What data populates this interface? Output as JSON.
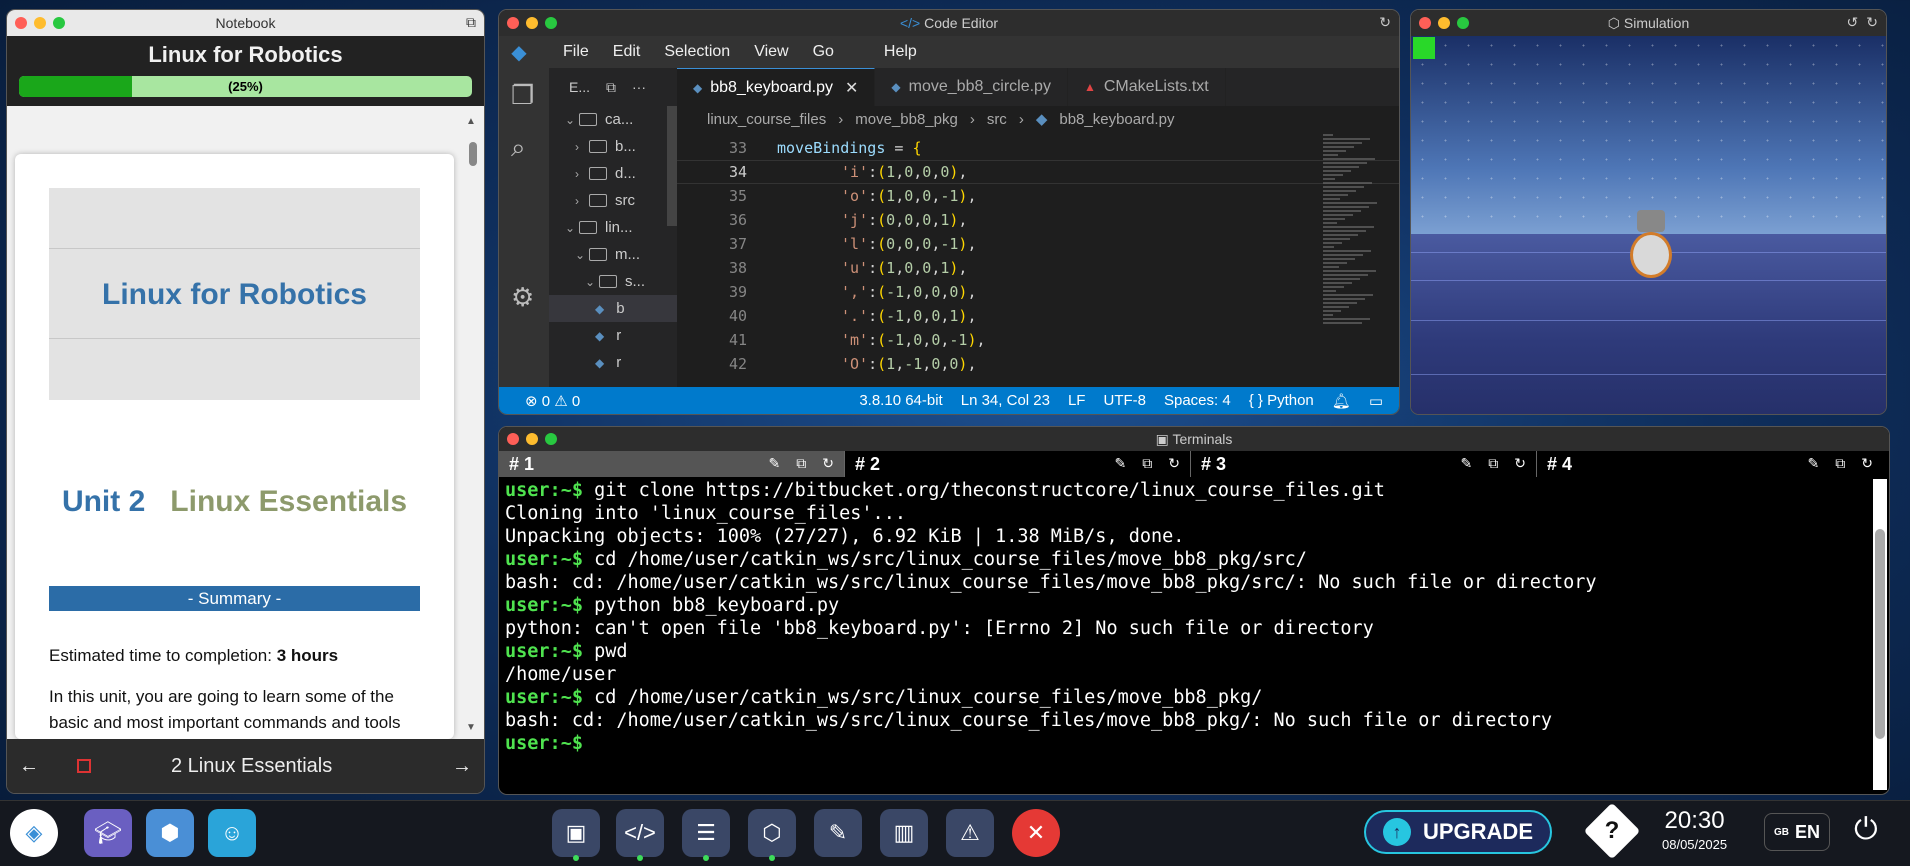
{
  "notebook": {
    "window_title": "Notebook",
    "header_title": "Linux for Robotics",
    "progress_label": "(25%)",
    "progress_fraction": 0.25,
    "hero_title": "Linux for Robotics",
    "unit_number": "Unit 2",
    "unit_name": "Linux Essentials",
    "summary_label": "- Summary -",
    "estimated_label": "Estimated time to completion: ",
    "estimated_value": "3 hours",
    "intro_text": "In this unit, you are going to learn some of the basic and most important commands and tools",
    "footer_label": "2  Linux Essentials"
  },
  "code_editor": {
    "window_title": "Code Editor",
    "menu": [
      "File",
      "Edit",
      "Selection",
      "View",
      "Go",
      "Help"
    ],
    "explorer_header": "E...",
    "tree": [
      {
        "label": "ca...",
        "indent": 0,
        "type": "folder-open"
      },
      {
        "label": "b...",
        "indent": 1,
        "type": "folder"
      },
      {
        "label": "d...",
        "indent": 1,
        "type": "folder"
      },
      {
        "label": "src",
        "indent": 1,
        "type": "folder"
      },
      {
        "label": "lin...",
        "indent": 0,
        "type": "folder-open"
      },
      {
        "label": "m...",
        "indent": 1,
        "type": "folder-open"
      },
      {
        "label": "s...",
        "indent": 2,
        "type": "folder-open"
      },
      {
        "label": "b",
        "indent": 3,
        "type": "file-selected"
      },
      {
        "label": "r",
        "indent": 3,
        "type": "file"
      },
      {
        "label": "r",
        "indent": 3,
        "type": "file"
      }
    ],
    "tabs": [
      {
        "label": "bb8_keyboard.py",
        "active": true
      },
      {
        "label": "move_bb8_circle.py",
        "active": false
      },
      {
        "label": "CMakeLists.txt",
        "active": false
      }
    ],
    "breadcrumb": [
      "linux_course_files",
      "move_bb8_pkg",
      "src",
      "bb8_keyboard.py"
    ],
    "code_lines": [
      {
        "num": "33",
        "text": "moveBindings = {"
      },
      {
        "num": "34",
        "text": "'i':(1,0,0,0),"
      },
      {
        "num": "35",
        "text": "'o':(1,0,0,-1),"
      },
      {
        "num": "36",
        "text": "'j':(0,0,0,1),"
      },
      {
        "num": "37",
        "text": "'l':(0,0,0,-1),"
      },
      {
        "num": "38",
        "text": "'u':(1,0,0,1),"
      },
      {
        "num": "39",
        "text": "',':(-1,0,0,0),"
      },
      {
        "num": "40",
        "text": "'.':(-1,0,0,1),"
      },
      {
        "num": "41",
        "text": "'m':(-1,0,0,-1),"
      },
      {
        "num": "42",
        "text": "'O':(1,-1,0,0),"
      }
    ],
    "status": {
      "problems": "⊗ 0 ⚠ 0",
      "python_version": "3.8.10 64-bit",
      "cursor": "Ln 34, Col 23",
      "eol": "LF",
      "encoding": "UTF-8",
      "spaces": "Spaces: 4",
      "language": "Python"
    }
  },
  "simulation": {
    "window_title": "Simulation"
  },
  "terminals": {
    "window_title": "Terminals",
    "tabs": [
      "# 1",
      "# 2",
      "# 3",
      "# 4"
    ],
    "lines": [
      {
        "prompt": "user:~$",
        "text": " git clone https://bitbucket.org/theconstructcore/linux_course_files.git"
      },
      {
        "prompt": "",
        "text": "Cloning into 'linux_course_files'..."
      },
      {
        "prompt": "",
        "text": "Unpacking objects: 100% (27/27), 6.92 KiB | 1.38 MiB/s, done."
      },
      {
        "prompt": "user:~$",
        "text": " cd /home/user/catkin_ws/src/linux_course_files/move_bb8_pkg/src/"
      },
      {
        "prompt": "",
        "text": "bash: cd: /home/user/catkin_ws/src/linux_course_files/move_bb8_pkg/src/: No such file or directory"
      },
      {
        "prompt": "user:~$",
        "text": " python bb8_keyboard.py"
      },
      {
        "prompt": "",
        "text": "python: can't open file 'bb8_keyboard.py': [Errno 2] No such file or directory"
      },
      {
        "prompt": "user:~$",
        "text": " pwd"
      },
      {
        "prompt": "",
        "text": "/home/user"
      },
      {
        "prompt": "user:~$",
        "text": " cd /home/user/catkin_ws/src/linux_course_files/move_bb8_pkg/"
      },
      {
        "prompt": "",
        "text": "bash: cd: /home/user/catkin_ws/src/linux_course_files/move_bb8_pkg/: No such file or directory"
      },
      {
        "prompt": "user:~$",
        "text": " "
      }
    ]
  },
  "taskbar": {
    "upgrade_label": "UPGRADE",
    "time": "20:30",
    "date": "08/05/2025",
    "lang_flag": "GB",
    "lang": "EN"
  }
}
